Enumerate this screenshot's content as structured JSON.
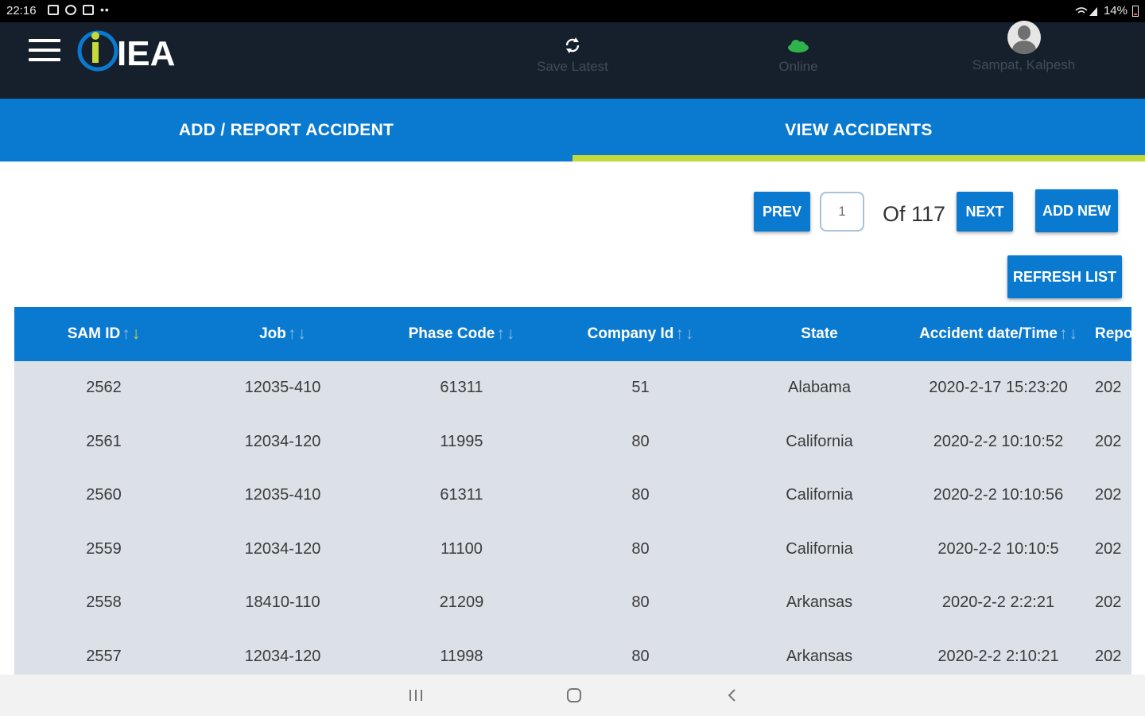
{
  "status_bar": {
    "time": "22:16",
    "battery": "14%"
  },
  "header": {
    "logo_text": "IEA",
    "sync_label": "Save Latest",
    "online_label": "Online",
    "user_name": "Sampat, Kalpesh"
  },
  "tabs": [
    {
      "label": "ADD / REPORT ACCIDENT",
      "active": false
    },
    {
      "label": "VIEW ACCIDENTS",
      "active": true
    }
  ],
  "pager": {
    "prev_label": "PREV",
    "page_value": "1",
    "of_text": "Of  117",
    "next_label": "NEXT",
    "add_new_label": "ADD NEW",
    "refresh_label": "REFRESH LIST"
  },
  "table": {
    "columns": [
      "SAM ID",
      "Job",
      "Phase Code",
      "Company Id",
      "State",
      "Accident date/Time",
      "Repo"
    ],
    "rows": [
      [
        "2562",
        "12035-410",
        "61311",
        "51",
        "Alabama",
        "2020-2-17 15:23:20",
        "202"
      ],
      [
        "2561",
        "12034-120",
        "11995",
        "80",
        "California",
        "2020-2-2 10:10:52",
        "202"
      ],
      [
        "2560",
        "12035-410",
        "61311",
        "80",
        "California",
        "2020-2-2 10:10:56",
        "202"
      ],
      [
        "2559",
        "12034-120",
        "11100",
        "80",
        "California",
        "2020-2-2 10:10:5",
        "202"
      ],
      [
        "2558",
        "18410-110",
        "21209",
        "80",
        "Arkansas",
        "2020-2-2 2:2:21",
        "202"
      ],
      [
        "2557",
        "12034-120",
        "11998",
        "80",
        "Arkansas",
        "2020-2-2 2:10:21",
        "202"
      ]
    ]
  },
  "colors": {
    "primary": "#0a7ad0",
    "header_bg": "#16202c",
    "accent": "#c5d93a",
    "row_bg": "#dce1e7",
    "online": "#2fb34a"
  }
}
